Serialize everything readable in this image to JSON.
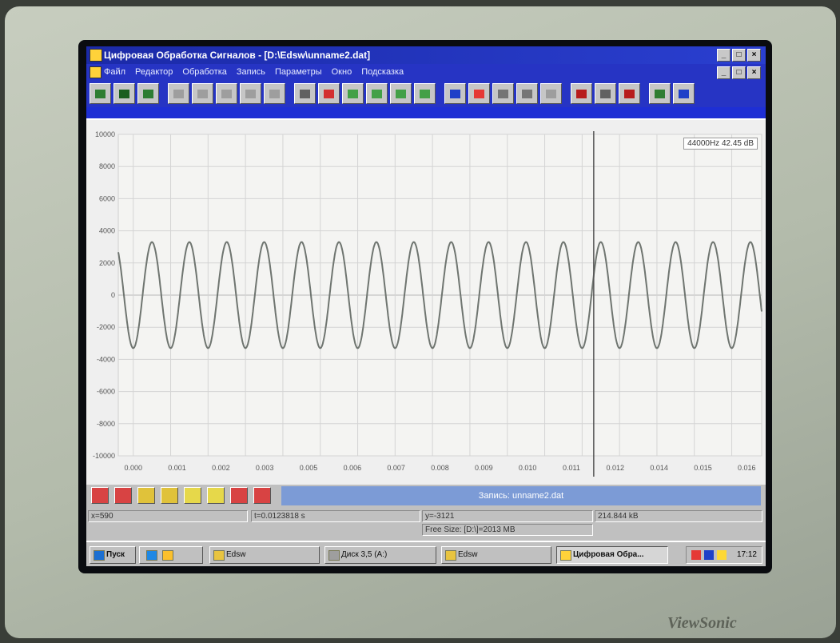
{
  "window": {
    "title": "Цифровая Обработка Сигналов - [D:\\Edsw\\unname2.dat]",
    "controls": [
      "_",
      "□",
      "×"
    ]
  },
  "menu": {
    "items": [
      "Файл",
      "Редактор",
      "Обработка",
      "Запись",
      "Параметры",
      "Окно",
      "Подсказка"
    ]
  },
  "toolbar": {
    "buttons": [
      {
        "icon": "open-icon",
        "color": "#2e7d32"
      },
      {
        "icon": "save-icon",
        "color": "#1b5e20"
      },
      {
        "icon": "edit-icon",
        "color": "#2e7d32"
      },
      {
        "icon": "zoom-in-icon",
        "color": "#9e9e9e"
      },
      {
        "icon": "zoom-out-icon",
        "color": "#9e9e9e"
      },
      {
        "icon": "zoom-fit-icon",
        "color": "#9e9e9e"
      },
      {
        "icon": "cut-icon",
        "color": "#9e9e9e"
      },
      {
        "icon": "copy-icon",
        "color": "#9e9e9e"
      },
      {
        "icon": "mic-icon",
        "color": "#616161"
      },
      {
        "icon": "record-icon",
        "color": "#d32f2f"
      },
      {
        "icon": "play-icon",
        "color": "#43a047"
      },
      {
        "icon": "pause-icon",
        "color": "#43a047"
      },
      {
        "icon": "step-icon",
        "color": "#43a047"
      },
      {
        "icon": "play-selection-icon",
        "color": "#43a047"
      },
      {
        "icon": "spectrum-icon",
        "color": "#1e40c8"
      },
      {
        "icon": "filter-icon",
        "color": "#e53935"
      },
      {
        "icon": "window-icon",
        "color": "#757575"
      },
      {
        "icon": "tile-icon",
        "color": "#757575"
      },
      {
        "icon": "wave-icon",
        "color": "#9e9e9e"
      },
      {
        "icon": "histogram-icon",
        "color": "#b71c1c"
      },
      {
        "icon": "histogram2-icon",
        "color": "#616161"
      },
      {
        "icon": "histogram3-icon",
        "color": "#b71c1c"
      },
      {
        "icon": "channels-icon",
        "color": "#2e7d32"
      },
      {
        "icon": "settings-icon",
        "color": "#1e40c8"
      }
    ]
  },
  "plot": {
    "rate_label": "44000Hz 42.45 dB",
    "cursor_time": 0.01231
  },
  "chart_data": {
    "type": "line",
    "title": "",
    "xlabel": "",
    "ylabel": "",
    "x_ticks": [
      "0.000",
      "0.001",
      "0.002",
      "0.003",
      "0.005",
      "0.006",
      "0.007",
      "0.008",
      "0.009",
      "0.010",
      "0.011",
      "0.012",
      "0.014",
      "0.015",
      "0.016"
    ],
    "y_ticks": [
      "10000",
      "8000",
      "6000",
      "4000",
      "2000",
      "0",
      "-2000",
      "-4000",
      "-6000",
      "-8000",
      "-10000"
    ],
    "ylim": [
      -10000,
      10000
    ],
    "xlim": [
      -0.0004,
      0.0168
    ],
    "grid": true,
    "series": [
      {
        "waveform": "sine",
        "amplitude": 3300,
        "frequency_hz": 1000,
        "phase_deg": -90,
        "x_start": -0.0004,
        "x_end": 0.0168,
        "color": "#6f7570"
      }
    ]
  },
  "recbar": {
    "buttons": [
      {
        "icon": "rec-a-icon",
        "color": "#d84343"
      },
      {
        "icon": "rec-b-icon",
        "color": "#d84343"
      },
      {
        "icon": "rec-c-icon",
        "color": "#e0c23a"
      },
      {
        "icon": "rec-d-icon",
        "color": "#e0c23a"
      },
      {
        "icon": "rec-e-icon",
        "color": "#e6d84a"
      },
      {
        "icon": "rec-f-icon",
        "color": "#e6d84a"
      },
      {
        "icon": "rec-g-icon",
        "color": "#d84343"
      },
      {
        "icon": "rec-h-icon",
        "color": "#d84343"
      }
    ],
    "record_name": "Запись: unname2.dat"
  },
  "status": {
    "left": "x=590",
    "time": "t=0.0123818 s",
    "y": "y=-3121",
    "size": "214.844 kB",
    "free": "Free Size: [D:\\]=2013 MB"
  },
  "taskbar": {
    "start": "Пуск",
    "tasks": [
      "Edsw",
      "Диск 3,5 (A:)",
      "Edsw",
      "Цифровая Обра..."
    ],
    "clock": "17:12"
  }
}
